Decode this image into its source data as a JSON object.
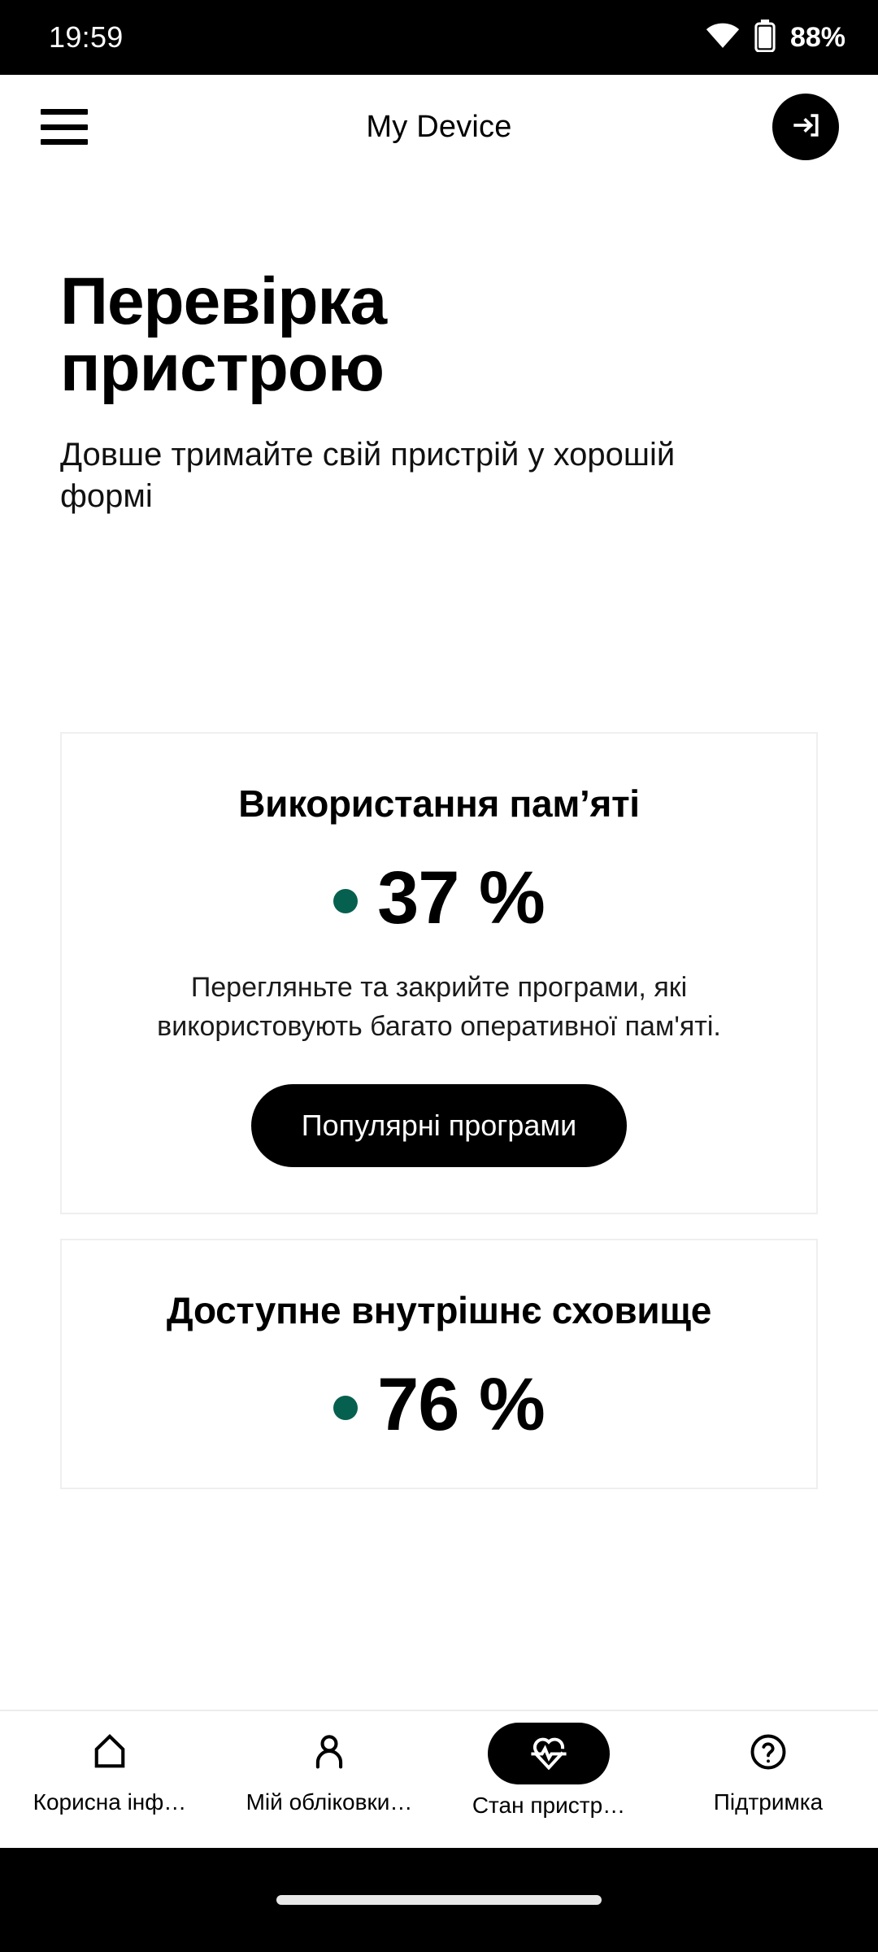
{
  "status_bar": {
    "time": "19:59",
    "battery_percent": "88%",
    "wifi_icon": "wifi-icon",
    "battery_icon": "battery-icon"
  },
  "app_bar": {
    "menu_icon": "hamburger-menu-icon",
    "title": "My Device",
    "login_icon": "login-arrow-icon"
  },
  "hero": {
    "title": "Перевірка пристрою",
    "subtitle": "Довше тримайте свій пристрій у хорошій формі"
  },
  "cards": [
    {
      "title": "Використання пам’яті",
      "dot_color": "#06604F",
      "value": "37 %",
      "description": "Перегляньте та закрийте програми, які використовують багато оперативної пам'яті.",
      "button_label": "Популярні програми"
    },
    {
      "title": "Доступне внутрішнє сховище",
      "dot_color": "#06604F",
      "value": "76 %",
      "description": "",
      "button_label": ""
    }
  ],
  "bottom_nav": [
    {
      "label": "Корисна інф…",
      "icon": "home-icon",
      "active": false
    },
    {
      "label": "Мій обліковки…",
      "icon": "person-icon",
      "active": false
    },
    {
      "label": "Стан пристр…",
      "icon": "heart-pulse-icon",
      "active": true
    },
    {
      "label": "Підтримка",
      "icon": "question-circle-icon",
      "active": false
    }
  ],
  "gesture_bar": {
    "home_indicator": "home-indicator"
  }
}
